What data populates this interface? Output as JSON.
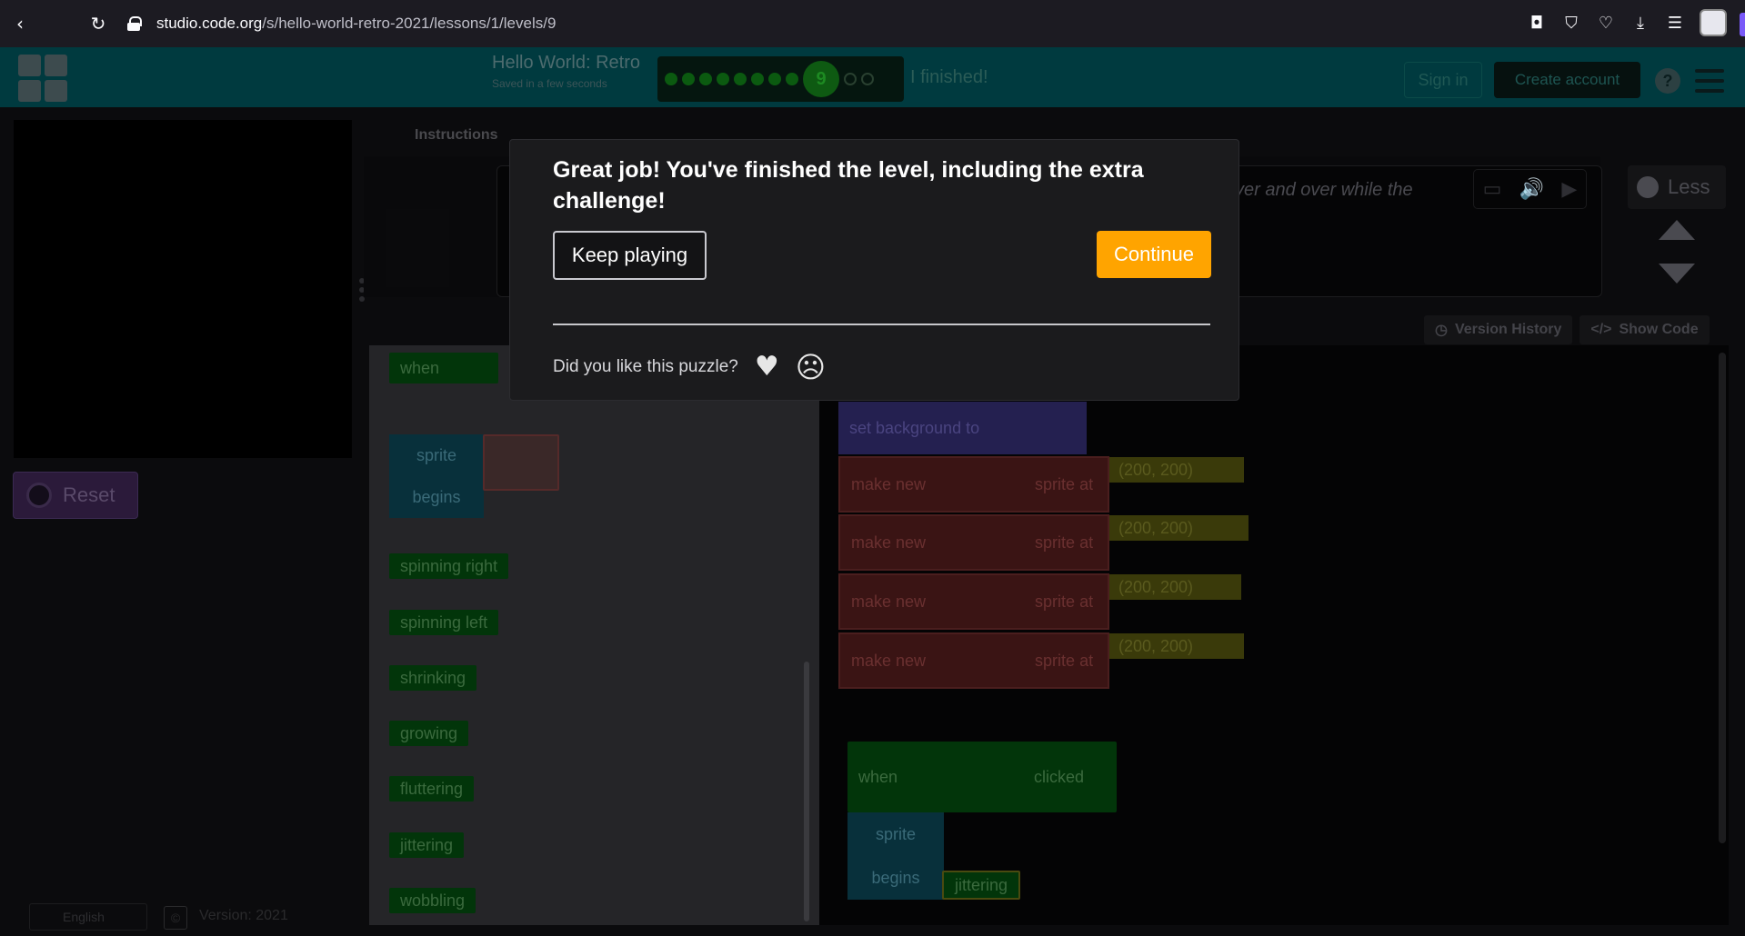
{
  "browser": {
    "url_host": "studio.code.org",
    "url_path": "/s/hello-world-retro-2021/lessons/1/levels/9",
    "back": "‹",
    "forward": "›",
    "reload": "↻"
  },
  "header": {
    "level_title": "Hello World: Retro",
    "saved": "Saved in a few seconds",
    "current_level": "9",
    "finished": "I finished!",
    "sign_in": "Sign in",
    "create_account": "Create account",
    "help": "?"
  },
  "workspace": {
    "reset": "Reset",
    "instructions_tab": "Instructions",
    "instructions_text": "ver and over while the",
    "less": "Less",
    "version_history": "Version History",
    "show_code": "Show Code",
    "footer_language": "English",
    "footer_version": "Version: 2021",
    "footer_copyright": "©"
  },
  "toolbox": {
    "when": "when",
    "sprite": "sprite",
    "begins": "begins",
    "behaviors": [
      "spinning right",
      "spinning left",
      "shrinking",
      "growing",
      "fluttering",
      "jittering",
      "wobbling"
    ]
  },
  "editor": {
    "set_background": "set background to",
    "make_new": "make new",
    "sprite_at": "sprite at",
    "coords": [
      "(200, 200)",
      "(200, 200)",
      "(200, 200)",
      "(200, 200)"
    ],
    "when": "when",
    "clicked": "clicked",
    "sprite": "sprite",
    "begins": "begins",
    "jittering": "jittering"
  },
  "dialog": {
    "message": "Great job! You've finished the level, including the extra challenge!",
    "keep_playing": "Keep playing",
    "continue": "Continue",
    "feedback_question": "Did you like this puzzle?",
    "heart_glyph": "♥",
    "sad_glyph": "☹"
  },
  "colors": {
    "continue": "#ffa400",
    "header_bg": "#003a3f",
    "dialog_bg": "#1b1b1d"
  }
}
